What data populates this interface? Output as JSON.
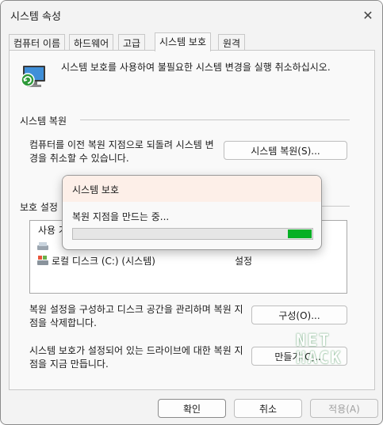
{
  "window": {
    "title": "시스템 속성",
    "close_glyph": "✕"
  },
  "tabs": [
    "컴퓨터 이름",
    "하드웨어",
    "고급",
    "시스템 보호",
    "원격"
  ],
  "active_tab": "시스템 보호",
  "intro": "시스템 보호를 사용하여 불필요한 시스템 변경을 실행 취소하십시오.",
  "restore": {
    "heading": "시스템 복원",
    "description": "컴퓨터를 이전 복원 지점으로 되돌려 시스템 변경을 취소할 수 있습니다.",
    "button": "시스템 복원(S)..."
  },
  "protection": {
    "heading": "보호 설정",
    "header_visible": "사용 가",
    "drives": [
      {
        "name": "",
        "status": "",
        "icon": "drive-icon"
      },
      {
        "name": "로컬 디스크 (C:) (시스템)",
        "status": "설정",
        "icon": "system-drive-icon"
      }
    ]
  },
  "configure": {
    "description": "복원 설정을 구성하고 디스크 공간을 관리하며 복원 지점을 삭제합니다.",
    "button": "구성(O)..."
  },
  "create": {
    "description": "시스템 보호가 설정되어 있는 드라이브에 대한 복원 지점을 지금 만듭니다.",
    "button": "만들기(C)..."
  },
  "footer": {
    "ok": "확인",
    "cancel": "취소",
    "apply": "적용(A)"
  },
  "progress_dialog": {
    "title": "시스템 보호",
    "message": "복원 지점을 만드는 중...",
    "progress_fraction": 0.1
  },
  "watermark": {
    "line1": "NET",
    "line2": "HACK"
  },
  "colors": {
    "progress_fill": "#06b025",
    "dialog_title_bg": "#fdefe8",
    "window_bg": "#f3f3f3"
  }
}
